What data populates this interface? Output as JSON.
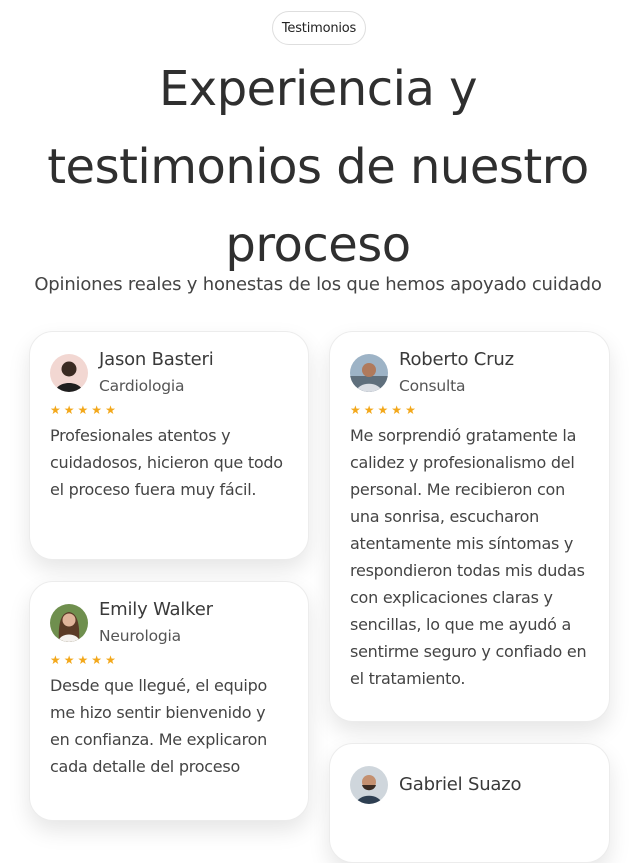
{
  "section": {
    "badge": "Testimonios",
    "title_line1": "Experiencia y",
    "title_line2": "testimonios de nuestro",
    "title_line3": "proceso",
    "subtitle": "Opiniones reales y honestas de los que hemos apoyado cuidado"
  },
  "testimonials": [
    {
      "name": "Jason Basteri",
      "specialty": "Cardiologia",
      "rating": 5,
      "text": "Profesionales atentos y cuidadosos, hicieron que todo el proceso fuera muy fácil."
    },
    {
      "name": "Roberto Cruz",
      "specialty": "Consulta",
      "rating": 5,
      "text": "Me sorprendió gratamente la calidez y profesionalismo del personal. Me recibieron con una sonrisa, escucharon atentamente mis síntomas y respondieron todas mis dudas con explicaciones claras y sencillas, lo que me ayudó a sentirme seguro y confiado en el tratamiento."
    },
    {
      "name": "Emily Walker",
      "specialty": "Neurologia",
      "rating": 5,
      "text": "Desde que llegué, el equipo me hizo sentir bienvenido y en confianza. Me explicaron cada detalle del proceso"
    },
    {
      "name": "Gabriel Suazo"
    }
  ],
  "colors": {
    "star": "#f3a81b",
    "title": "#2f2f2f",
    "card_border": "#ececec"
  },
  "icons": {
    "star": "star-icon",
    "avatar": "user-photo-avatar"
  }
}
